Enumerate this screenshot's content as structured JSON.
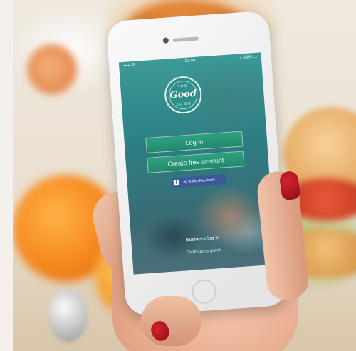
{
  "phone": {
    "status_bar": {
      "carrier": "••••• ≋",
      "time": "12:48",
      "battery": "⁎ 43% ▭"
    },
    "logo": {
      "line_top": "TOO",
      "line_mid": "Good",
      "line_bottom": "TO GO"
    },
    "buttons": {
      "log_in": "Log in",
      "create_account": "Create free account",
      "facebook": "Log in with Facebook",
      "facebook_icon": "f"
    },
    "links": {
      "business": "Business log in",
      "continue_guest": "Continue as guest"
    }
  },
  "colors": {
    "accent_green": "#23896c",
    "facebook_blue": "#3b5998",
    "nail_red": "#b0141f"
  },
  "icons": [
    "facebook-icon"
  ]
}
